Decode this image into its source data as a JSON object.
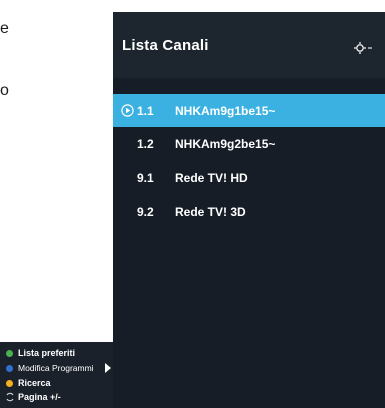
{
  "background": {
    "fragment_1": "e",
    "fragment_2": "o"
  },
  "panel": {
    "title": "Lista Canali",
    "settings_icon": "settings-gear-icon",
    "colors": {
      "panel_bg": "#161d26",
      "header_bg": "#1d252f",
      "selected_bg": "#3ab1e0"
    }
  },
  "channels": [
    {
      "number": "1.1",
      "name": "NHKAm9g1be15~",
      "selected": true,
      "icon": "play-circle-icon"
    },
    {
      "number": "1.2",
      "name": "NHKAm9g2be15~",
      "selected": false
    },
    {
      "number": "9.1",
      "name": "Rede TV! HD",
      "selected": false
    },
    {
      "number": "9.2",
      "name": "Rede TV! 3D",
      "selected": false
    }
  ],
  "help": {
    "items": [
      {
        "label": "Lista preferiti",
        "color": "#4caf50",
        "icon": "green-dot-icon"
      },
      {
        "label": "Modifica Programmi",
        "color": "#2f6fd0",
        "icon": "blue-dot-icon"
      },
      {
        "label": "Ricerca",
        "color": "#f2b01e",
        "icon": "yellow-dot-icon"
      },
      {
        "label": "Pagina +/-",
        "color": "#d0d0d0",
        "icon": "page-updown-icon"
      }
    ]
  }
}
